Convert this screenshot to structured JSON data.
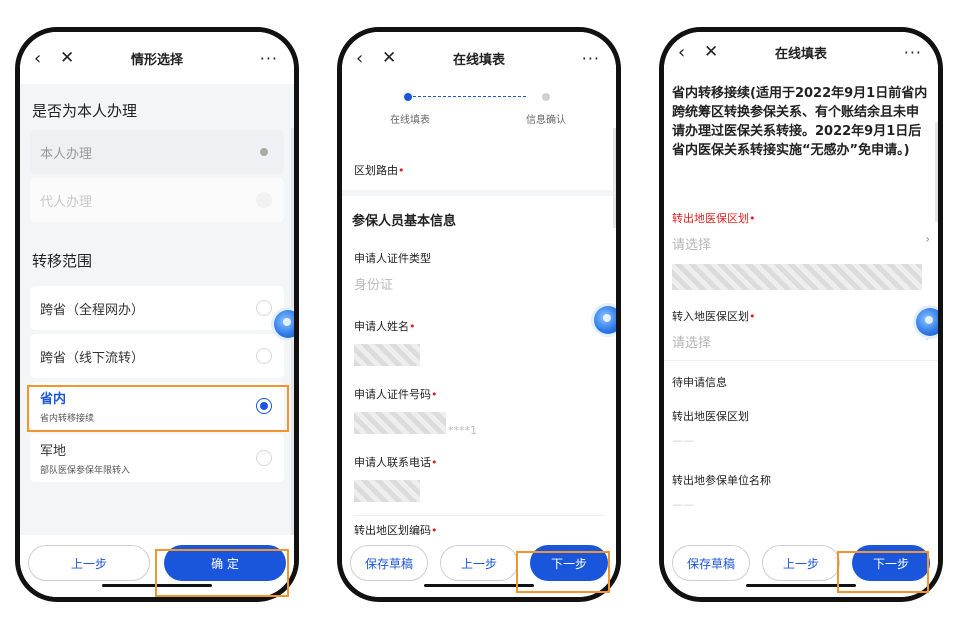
{
  "phone1": {
    "nav_title": "情形选择",
    "back": "‹",
    "close": "✕",
    "more": "···",
    "section1_title": "是否为本人办理",
    "self_option": "本人办理",
    "proxy_option": "代人办理",
    "section2_title": "转移范围",
    "range_options": [
      {
        "label": "跨省（全程网办）",
        "sub": ""
      },
      {
        "label": "跨省（线下流转）",
        "sub": ""
      },
      {
        "label": "省内",
        "sub": "省内转移接续"
      },
      {
        "label": "军地",
        "sub": "部队医保参保年限转入"
      }
    ],
    "prev_label": "上一步",
    "confirm_label": "确 定"
  },
  "phone2": {
    "nav_title": "在线填表",
    "back": "‹",
    "close": "✕",
    "more": "···",
    "step1": "在线填表",
    "step2": "信息确认",
    "route_label": "区划路由",
    "section_title": "参保人员基本信息",
    "id_type_label": "申请人证件类型",
    "id_type_value": "身份证",
    "name_label": "申请人姓名",
    "id_no_label": "申请人证件号码",
    "id_no_suffix": "****1",
    "phone_label": "申请人联系电话",
    "region_code_label": "转出地区划编码",
    "required_mark": "•",
    "draft_label": "保存草稿",
    "prev_label": "上一步",
    "next_label": "下一步"
  },
  "phone3": {
    "nav_title": "在线填表",
    "back": "‹",
    "close": "✕",
    "more": "···",
    "notice": "省内转移接续(适用于2022年9月1日前省内跨统筹区转换参保关系、有个账结余且未申请办理过医保关系转接。2022年9月1日后省内医保关系转接实施“无感办”免申请。)",
    "out_area_label": "转出地医保区划",
    "out_area_placeholder": "请选择",
    "in_area_label": "转入地医保区划",
    "in_area_placeholder": "请选择",
    "pending_title": "待申请信息",
    "pending_out_area_label": "转出地医保区划",
    "pending_out_area_value": "——",
    "pending_unit_label": "转出地参保单位名称",
    "pending_unit_value": "——",
    "required_mark": "•",
    "chevron": "›",
    "draft_label": "保存草稿",
    "prev_label": "上一步",
    "next_label": "下一步"
  },
  "colors": {
    "accent": "#1a56db",
    "highlight": "#f2952f",
    "required": "#e02020"
  }
}
